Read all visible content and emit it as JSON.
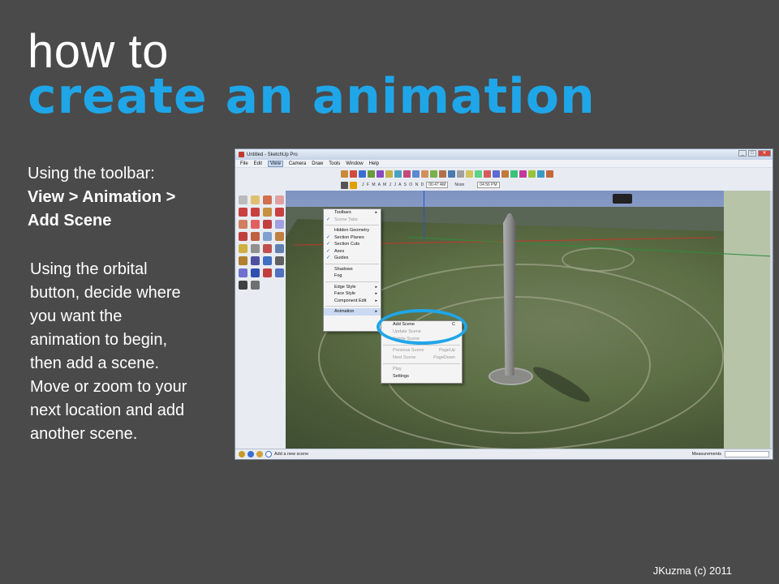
{
  "slide": {
    "title_line1": "how to",
    "title_line2": "create an animation",
    "toolbar_intro": "Using the toolbar:",
    "toolbar_path_line1": "View > Animation >",
    "toolbar_path_line2": "Add Scene",
    "orbital_instructions": "Using the orbital button, decide where you want the animation to begin, then add a scene. Move or zoom to your next location and add another scene.",
    "footer": "JKuzma (c) 2011",
    "accent_color": "#1fa6e8"
  },
  "window": {
    "title": "Untitled - SketchUp Pro",
    "controls": [
      "minimize-icon",
      "maximize-icon",
      "close-icon"
    ],
    "menubar": [
      "File",
      "Edit",
      "View",
      "Camera",
      "Draw",
      "Tools",
      "Window",
      "Help"
    ],
    "active_menu": "View",
    "shadow_months": "J F M A M J J A S O N D",
    "shadow_time_start": "06:47 AM",
    "shadow_noon": "Noon",
    "shadow_time_end": "04:56 PM"
  },
  "view_menu": {
    "items": [
      {
        "label": "Toolbars",
        "check": false,
        "submenu": true,
        "disabled": false
      },
      {
        "label": "Scene Tabs",
        "check": true,
        "submenu": false,
        "disabled": true
      },
      {
        "label": "Hidden Geometry",
        "check": false,
        "submenu": false,
        "disabled": false
      },
      {
        "label": "Section Planes",
        "check": true,
        "submenu": false,
        "disabled": false
      },
      {
        "label": "Section Cuts",
        "check": true,
        "submenu": false,
        "disabled": false
      },
      {
        "label": "Axes",
        "check": true,
        "submenu": false,
        "disabled": false
      },
      {
        "label": "Guides",
        "check": true,
        "submenu": false,
        "disabled": false
      },
      {
        "label": "Shadows",
        "check": false,
        "submenu": false,
        "disabled": false
      },
      {
        "label": "Fog",
        "check": false,
        "submenu": false,
        "disabled": false
      },
      {
        "label": "Edge Style",
        "check": false,
        "submenu": true,
        "disabled": false
      },
      {
        "label": "Face Style",
        "check": false,
        "submenu": true,
        "disabled": false
      },
      {
        "label": "Component Edit",
        "check": false,
        "submenu": true,
        "disabled": false
      },
      {
        "label": "Animation",
        "check": false,
        "submenu": true,
        "disabled": false
      }
    ]
  },
  "animation_menu": {
    "items": [
      {
        "label": "Add Scene",
        "key": "C",
        "disabled": false
      },
      {
        "label": "Update Scene",
        "key": "",
        "disabled": true
      },
      {
        "label": "Delete Scene",
        "key": "",
        "disabled": true
      },
      {
        "label": "Previous Scene",
        "key": "PageUp",
        "disabled": true
      },
      {
        "label": "Next Scene",
        "key": "PageDown",
        "disabled": true
      },
      {
        "label": "Play",
        "key": "",
        "disabled": true
      },
      {
        "label": "Settings",
        "key": "",
        "disabled": false
      }
    ]
  },
  "statusbar": {
    "hint": "Add a new scene",
    "measurements_label": "Measurements"
  }
}
